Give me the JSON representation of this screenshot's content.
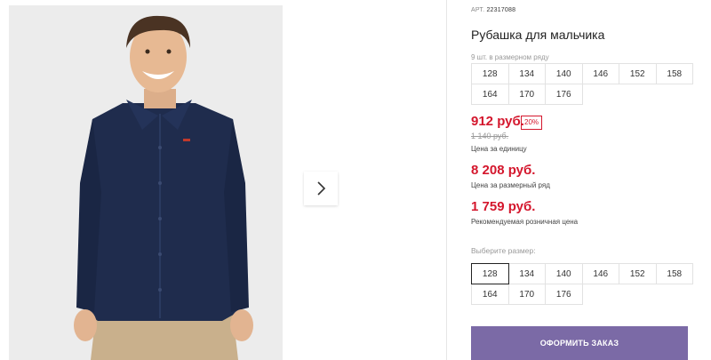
{
  "product": {
    "art_label": "АРТ.",
    "art_number": "22317088",
    "title": "Рубашка для мальчика",
    "row_label": "9 шт. в размерном ряду",
    "row_sizes": [
      "128",
      "134",
      "140",
      "146",
      "152",
      "158",
      "164",
      "170",
      "176"
    ],
    "price_unit": "912 руб.",
    "discount": "20%",
    "old_price": "1 140 руб.",
    "price_unit_caption": "Цена за единицу",
    "price_row": "8 208 руб.",
    "price_row_caption": "Цена за размерный ряд",
    "price_retail": "1 759 руб.",
    "price_retail_caption": "Рекомендуемая розничная цена",
    "choose_label": "Выберите размер:",
    "pick_sizes": [
      "128",
      "134",
      "140",
      "146",
      "152",
      "158",
      "164",
      "170",
      "176"
    ],
    "selected_size": "128",
    "order_button": "ОФОРМИТЬ ЗАКАЗ"
  },
  "colors": {
    "price_red": "#d4172d",
    "button_purple": "#7b6aa6",
    "shirt_navy": "#1f2c4d"
  },
  "icons": {
    "gallery_next": "chevron-right-icon"
  }
}
